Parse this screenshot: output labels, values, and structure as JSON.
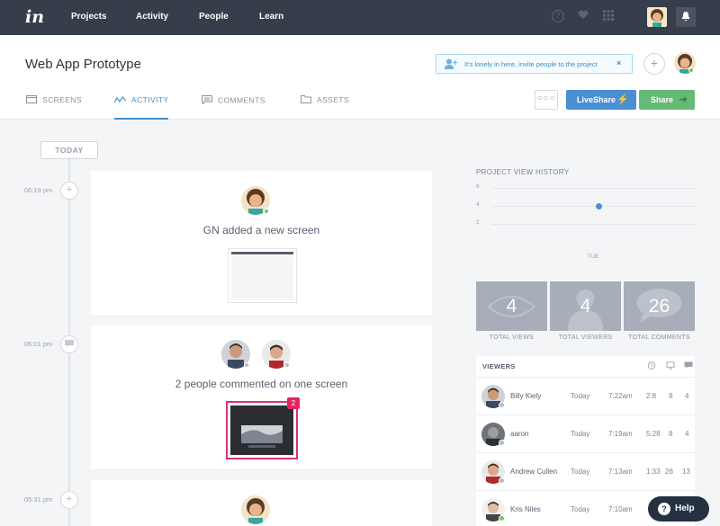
{
  "nav": {
    "logo": "in",
    "links": [
      "Projects",
      "Activity",
      "People",
      "Learn"
    ],
    "icons": [
      "help-icon",
      "heart-icon",
      "apps-grid-icon",
      "bell-icon"
    ]
  },
  "header": {
    "project_title": "Web App Prototype",
    "invite_text": "It's lonely in here, invite people to the project",
    "invite_close": "×",
    "add_label": "+",
    "tabs": [
      {
        "label": "SCREENS",
        "icon": "screens-icon"
      },
      {
        "label": "ACTIVITY",
        "icon": "activity-icon"
      },
      {
        "label": "COMMENTS",
        "icon": "comments-icon"
      },
      {
        "label": "ASSETS",
        "icon": "folder-icon"
      }
    ],
    "more_label": "○○○",
    "liveshare_label": "LiveShare",
    "share_label": "Share",
    "colors": {
      "liveshare": "#4a8fd4",
      "share": "#65bb75",
      "active_tab": "#3f8fd2"
    }
  },
  "timeline": {
    "today_label": "TODAY",
    "events": [
      {
        "time": "06:19 pm",
        "node_icon": "+",
        "text": "GN added a new screen"
      },
      {
        "time": "06:01 pm",
        "node_icon": "●",
        "text": "2 people commented on one screen",
        "comment_count": "2"
      },
      {
        "time": "05:31 pm",
        "node_icon": "+",
        "text": ""
      }
    ]
  },
  "history": {
    "title": "PROJECT VIEW HISTORY",
    "chart_data": {
      "type": "line",
      "categories": [
        "TUE"
      ],
      "series": [
        {
          "values": [
            4
          ]
        }
      ],
      "yticks": [
        6,
        4,
        2
      ],
      "ylim": [
        2,
        6
      ]
    }
  },
  "stats": [
    {
      "value": "4",
      "label": "TOTAL VIEWS",
      "icon": "eye-icon"
    },
    {
      "value": "4",
      "label": "TOTAL VIEWERS",
      "icon": "person-icon"
    },
    {
      "value": "26",
      "label": "TOTAL COMMENTS",
      "icon": "comment-bubble-icon"
    }
  ],
  "viewers": {
    "title": "VIEWERS",
    "header_icons": [
      "clock-icon",
      "monitor-icon",
      "comment-icon"
    ],
    "rows": [
      {
        "name": "Billy Kiely",
        "day": "Today",
        "time": "7:22am",
        "duration": "2:8",
        "screens": "8",
        "comments": "4"
      },
      {
        "name": "aaron",
        "day": "Today",
        "time": "7:19am",
        "duration": "5:28",
        "screens": "8",
        "comments": "4"
      },
      {
        "name": "Andrew Cullen",
        "day": "Today",
        "time": "7:13am",
        "duration": "1:33",
        "screens": "26",
        "comments": "13"
      },
      {
        "name": "Kris Niles",
        "day": "Today",
        "time": "7:10am",
        "duration": "",
        "screens": "",
        "comments": ""
      }
    ]
  },
  "help_label": "Help"
}
